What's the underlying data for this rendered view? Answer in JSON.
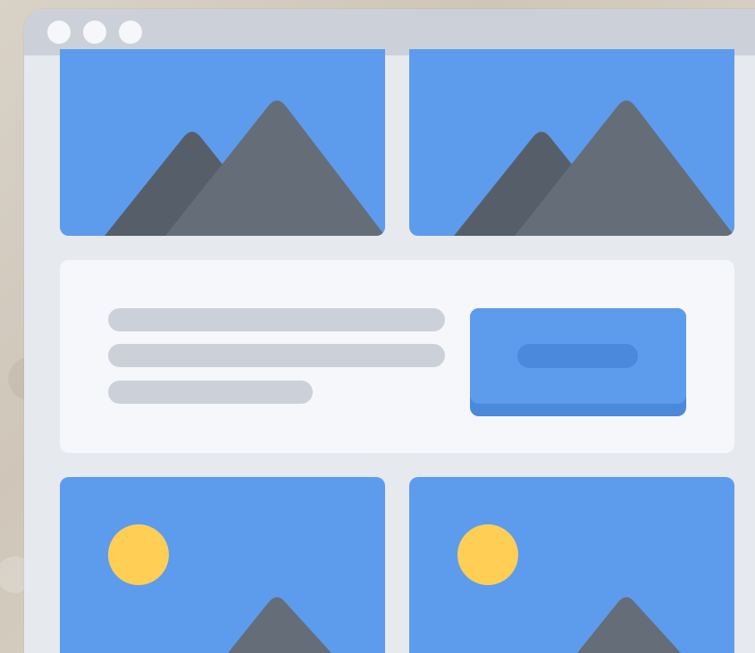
{
  "window": {
    "controls": [
      {
        "name": "window-control-1"
      },
      {
        "name": "window-control-2"
      },
      {
        "name": "window-control-3"
      }
    ]
  },
  "colors": {
    "page_background": "#d7cec2",
    "frame": "#e6e9ee",
    "titlebar": "#ccd1d9",
    "image_blue": "#5d9cec",
    "button_blue": "#5d9cec",
    "button_shadow": "#4a89dc",
    "mountain_dark": "#565f69",
    "mountain_light": "#656d78",
    "sun_yellow": "#ffce54",
    "text_placeholder": "#ccd1d9",
    "content_background": "#f5f7fa"
  },
  "content": {
    "image_tiles": [
      {
        "type": "mountain-image",
        "label": ""
      },
      {
        "type": "mountain-image",
        "label": ""
      },
      {
        "type": "sun-mountain-image",
        "label": ""
      },
      {
        "type": "sun-mountain-image",
        "label": ""
      }
    ],
    "text_lines": [
      {
        "type": "placeholder-line"
      },
      {
        "type": "placeholder-line"
      },
      {
        "type": "placeholder-line"
      }
    ],
    "button": {
      "label": "",
      "type": "placeholder-button"
    }
  },
  "icons": {
    "window_dots": "circle",
    "image_placeholder": "mountain-icon",
    "sun": "sun-icon"
  }
}
